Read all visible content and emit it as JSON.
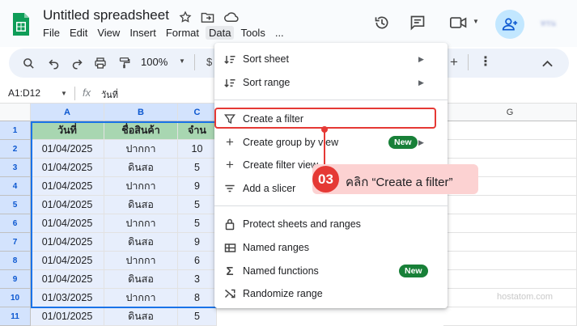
{
  "app": {
    "title": "Untitled spreadsheet",
    "menus": [
      "File",
      "Edit",
      "View",
      "Insert",
      "Format",
      "Data",
      "Tools",
      "..."
    ],
    "user_blurred": "ทรน"
  },
  "toolbar": {
    "zoom": "100%",
    "currency": "$"
  },
  "formula_bar": {
    "name_box": "A1:D12",
    "fx": "fx",
    "value": "วันที่"
  },
  "sheet": {
    "columns": [
      "A",
      "B",
      "C",
      "G"
    ],
    "header": [
      "วันที่",
      "ชื่อสินค้า",
      "จำน"
    ],
    "rows": [
      [
        "1"
      ],
      [
        "2",
        "01/04/2025",
        "ปากกา",
        "10"
      ],
      [
        "3",
        "01/04/2025",
        "ดินสอ",
        "5"
      ],
      [
        "4",
        "01/04/2025",
        "ปากกา",
        "9"
      ],
      [
        "5",
        "01/04/2025",
        "ดินสอ",
        "5"
      ],
      [
        "6",
        "01/04/2025",
        "ปากกา",
        "5"
      ],
      [
        "7",
        "01/04/2025",
        "ดินสอ",
        "9"
      ],
      [
        "8",
        "01/04/2025",
        "ปากกา",
        "6"
      ],
      [
        "9",
        "01/04/2025",
        "ดินสอ",
        "3"
      ],
      [
        "10",
        "01/03/2025",
        "ปากกา",
        "8"
      ],
      [
        "11",
        "01/01/2025",
        "ดินสอ",
        "5"
      ]
    ]
  },
  "data_menu": {
    "items": [
      {
        "label": "Sort sheet",
        "icon": "sort-icon",
        "submenu": true
      },
      {
        "label": "Sort range",
        "icon": "sort-range-icon",
        "submenu": true
      },
      {
        "label": "Create a filter",
        "icon": "filter-icon"
      },
      {
        "label": "Create group by view",
        "icon": "plus-icon",
        "badge": "New",
        "submenu": true
      },
      {
        "label": "Create filter view",
        "icon": "plus-icon"
      },
      {
        "label": "Add a slicer",
        "icon": "slicer-icon"
      },
      {
        "label": "Protect sheets and ranges",
        "icon": "lock-icon"
      },
      {
        "label": "Named ranges",
        "icon": "named-ranges-icon"
      },
      {
        "label": "Named functions",
        "icon": "sigma-icon",
        "badge": "New"
      },
      {
        "label": "Randomize range",
        "icon": "shuffle-icon"
      }
    ]
  },
  "callout": {
    "step": "03",
    "text": "คลิก “Create a filter”"
  },
  "watermark": "hostatom.com",
  "colors": {
    "accent": "#1a73e8",
    "callout_red": "#e53935",
    "callout_bg": "#fcd2d2",
    "header_green": "#a8d6b1",
    "new_badge": "#188038"
  }
}
